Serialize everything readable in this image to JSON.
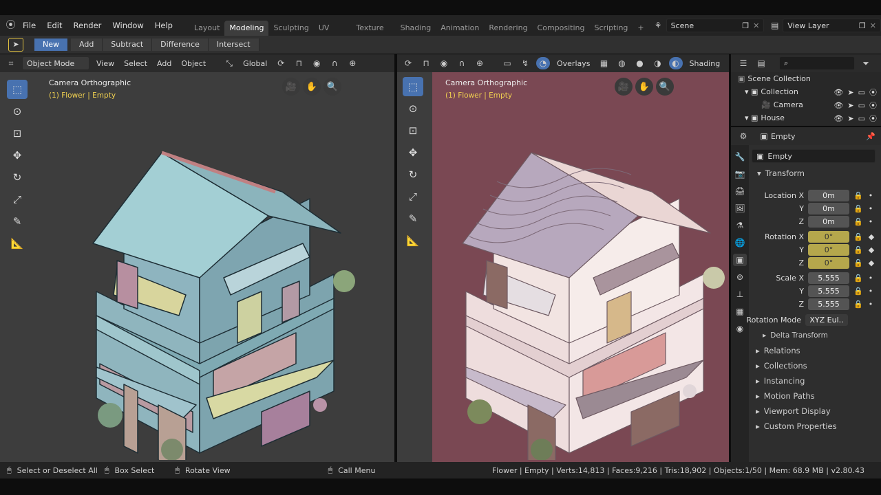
{
  "menu": [
    "File",
    "Edit",
    "Render",
    "Window",
    "Help"
  ],
  "workspaces": [
    "Layout",
    "Modeling",
    "Sculpting",
    "UV Editing",
    "Texture Paint",
    "Shading",
    "Animation",
    "Rendering",
    "Compositing",
    "Scripting"
  ],
  "active_workspace": "Modeling",
  "scene": "Scene",
  "view_layer": "View Layer",
  "bool_buttons": [
    "New",
    "Add",
    "Subtract",
    "Difference",
    "Intersect"
  ],
  "left_header": {
    "mode": "Object Mode",
    "view": "View",
    "select": "Select",
    "add": "Add",
    "object": "Object",
    "orientation": "Global"
  },
  "right_header": {
    "overlays": "Overlays",
    "shading": "Shading"
  },
  "viewport_title": "Camera Orthographic",
  "viewport_sub": "(1) Flower | Empty",
  "outliner": {
    "rows": [
      "Scene Collection",
      "Collection",
      "Camera",
      "House"
    ]
  },
  "props": {
    "object_name": "Empty",
    "data_name": "Empty",
    "transform": "Transform",
    "location": {
      "label": "Location X",
      "y": "Y",
      "z": "Z",
      "vals": [
        "0m",
        "0m",
        "0m"
      ]
    },
    "rotation": {
      "label": "Rotation X",
      "y": "Y",
      "z": "Z",
      "vals": [
        "0°",
        "0°",
        "0°"
      ]
    },
    "scale": {
      "label": "Scale X",
      "y": "Y",
      "z": "Z",
      "vals": [
        "5.555",
        "5.555",
        "5.555"
      ]
    },
    "rotation_mode_label": "Rotation Mode",
    "rotation_mode": "XYZ Eul..",
    "delta": "Delta Transform",
    "sections": [
      "Relations",
      "Collections",
      "Instancing",
      "Motion Paths",
      "Viewport Display",
      "Custom Properties"
    ]
  },
  "status": {
    "select": "Select or Deselect All",
    "box": "Box Select",
    "rotate": "Rotate View",
    "call": "Call Menu",
    "info": "Flower | Empty | Verts:14,813 | Faces:9,216 | Tris:18,902 | Objects:1/50 | Mem: 68.9 MB | v2.80.43"
  },
  "colors": {
    "accent": "#4872b0",
    "left_bg": "#3d3d3d",
    "right_bg": "#7a4853",
    "rotation_field": "#b5a74c",
    "subtitle": "#f0d050"
  }
}
